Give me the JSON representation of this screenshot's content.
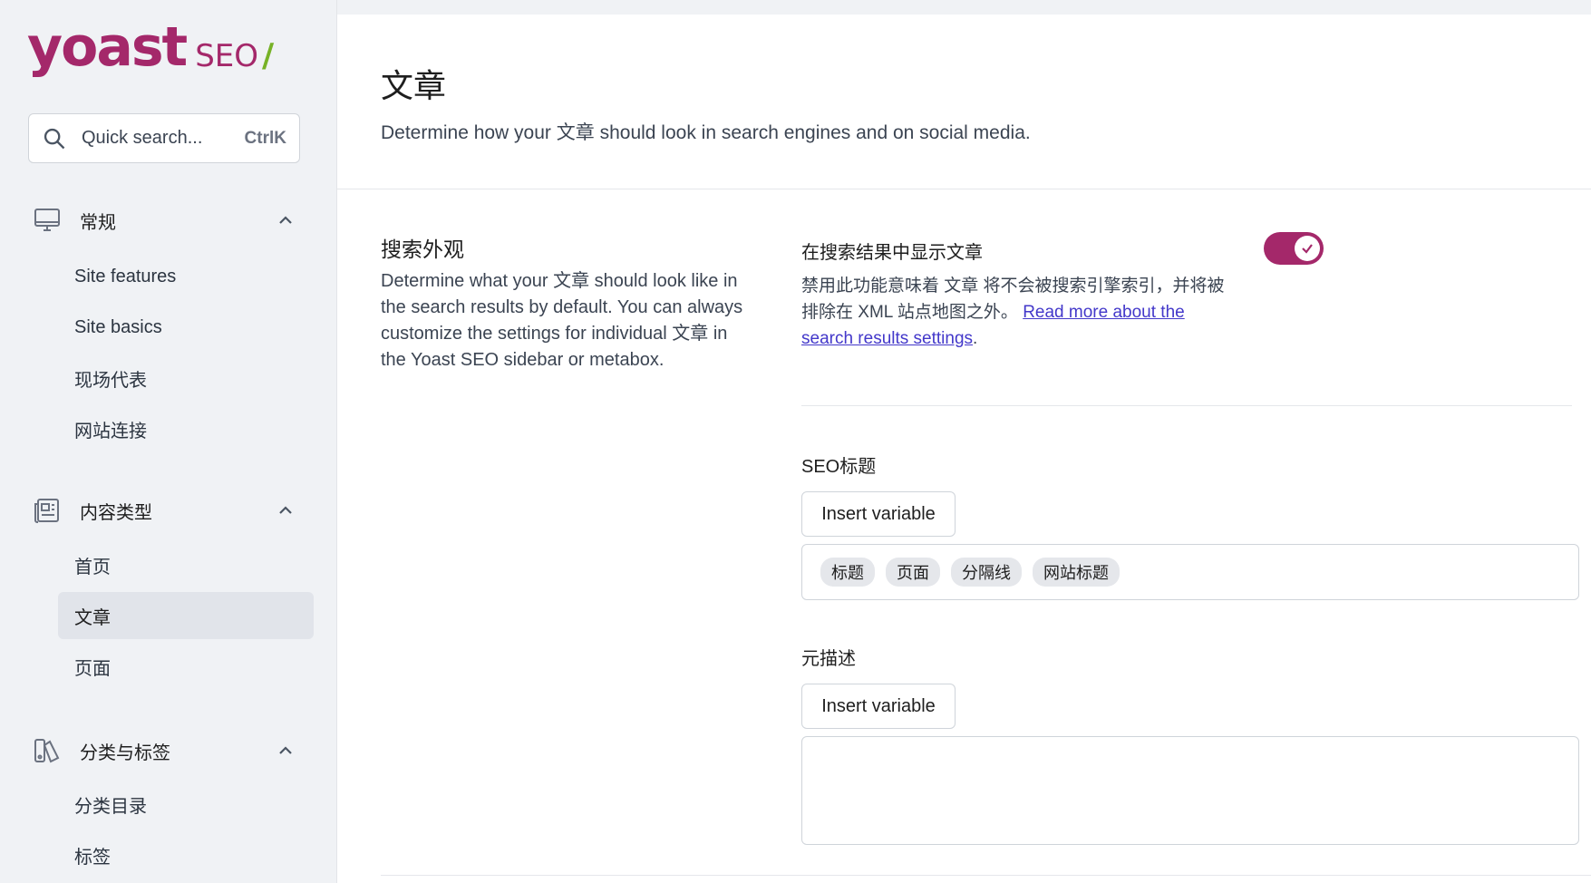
{
  "brand": {
    "wordmark": "yoast",
    "product": "SEO",
    "slash": "/",
    "accent": "#a4286a",
    "slash_color": "#77b227"
  },
  "search": {
    "placeholder": "Quick search...",
    "shortcut": "CtrlK",
    "icon": "search-icon"
  },
  "sidebar": {
    "groups": [
      {
        "label": "常规",
        "icon": "monitor-icon",
        "expanded": true,
        "items": [
          {
            "label": "Site features"
          },
          {
            "label": "Site basics"
          },
          {
            "label": "现场代表"
          },
          {
            "label": "网站连接"
          }
        ]
      },
      {
        "label": "内容类型",
        "icon": "content-types-icon",
        "expanded": true,
        "items": [
          {
            "label": "首页"
          },
          {
            "label": "文章",
            "active": true
          },
          {
            "label": "页面"
          }
        ]
      },
      {
        "label": "分类与标签",
        "icon": "categories-tags-icon",
        "expanded": true,
        "items": [
          {
            "label": "分类目录"
          },
          {
            "label": "标签"
          }
        ]
      }
    ]
  },
  "main": {
    "title": "文章",
    "description": "Determine how your 文章 should look in search engines and on social media.",
    "section": {
      "title": "搜索外观",
      "description": "Determine what your 文章 should look like in the search results by default. You can always customize the settings for individual 文章 in the Yoast SEO sidebar or metabox."
    },
    "toggle": {
      "label": "在搜索结果中显示文章",
      "enabled": true,
      "description": "禁用此功能意味着 文章 将不会被搜索引擎索引，并将被排除在 XML 站点地图之外。",
      "link_text": "Read more about the search results settings",
      "link_suffix": "."
    },
    "seo_title": {
      "label": "SEO标题",
      "insert_button": "Insert variable",
      "chips": [
        "标题",
        "页面",
        "分隔线",
        "网站标题"
      ]
    },
    "meta_description": {
      "label": "元描述",
      "insert_button": "Insert variable",
      "value": ""
    }
  }
}
